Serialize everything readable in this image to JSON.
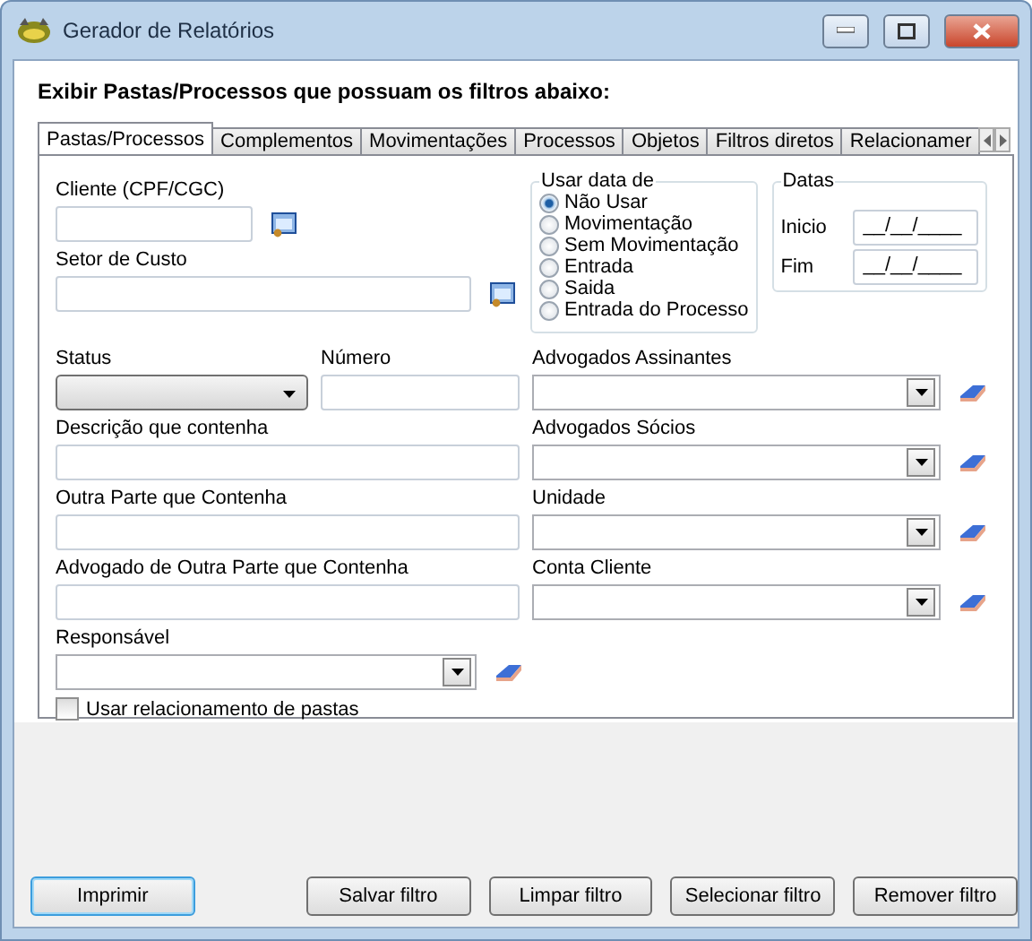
{
  "window": {
    "title": "Gerador de Relatórios"
  },
  "heading": "Exibir Pastas/Processos que possuam os filtros abaixo:",
  "tabs": [
    {
      "label": "Pastas/Processos",
      "selected": true
    },
    {
      "label": "Complementos",
      "selected": false
    },
    {
      "label": "Movimentações",
      "selected": false
    },
    {
      "label": "Processos",
      "selected": false
    },
    {
      "label": "Objetos",
      "selected": false
    },
    {
      "label": "Filtros diretos",
      "selected": false
    },
    {
      "label": "Relacionamer",
      "selected": false
    }
  ],
  "cliente": {
    "label": "Cliente (CPF/CGC)"
  },
  "setor": {
    "label": "Setor de Custo"
  },
  "usar_data_de": {
    "label": "Usar data de",
    "options": [
      {
        "label": "Não Usar",
        "selected": true
      },
      {
        "label": "Movimentação",
        "selected": false
      },
      {
        "label": "Sem Movimentação",
        "selected": false
      },
      {
        "label": "Entrada",
        "selected": false
      },
      {
        "label": "Saida",
        "selected": false
      },
      {
        "label": "Entrada do Processo",
        "selected": false
      }
    ]
  },
  "datas": {
    "label": "Datas",
    "fields": [
      {
        "label": "Inicio",
        "value": "__/__/____"
      },
      {
        "label": "Fim",
        "value": "__/__/____"
      }
    ]
  },
  "status": {
    "label": "Status"
  },
  "numero": {
    "label": "Número"
  },
  "text_fields": [
    {
      "label": "Descrição que contenha"
    },
    {
      "label": "Outra Parte que Contenha"
    },
    {
      "label": "Advogado de Outra Parte que Contenha"
    }
  ],
  "right_combos": [
    {
      "label": "Advogados Assinantes"
    },
    {
      "label": "Advogados Sócios"
    },
    {
      "label": "Unidade"
    },
    {
      "label": "Conta Cliente"
    }
  ],
  "responsavel": {
    "label": "Responsável"
  },
  "usar_relacionamento": {
    "label": "Usar relacionamento de pastas",
    "checked": false
  },
  "buttons": [
    {
      "label": "Imprimir",
      "default": true
    },
    {
      "label": "Salvar filtro",
      "default": false
    },
    {
      "label": "Limpar filtro",
      "default": false
    },
    {
      "label": "Selecionar filtro",
      "default": false
    },
    {
      "label": "Remover filtro",
      "default": false
    }
  ]
}
